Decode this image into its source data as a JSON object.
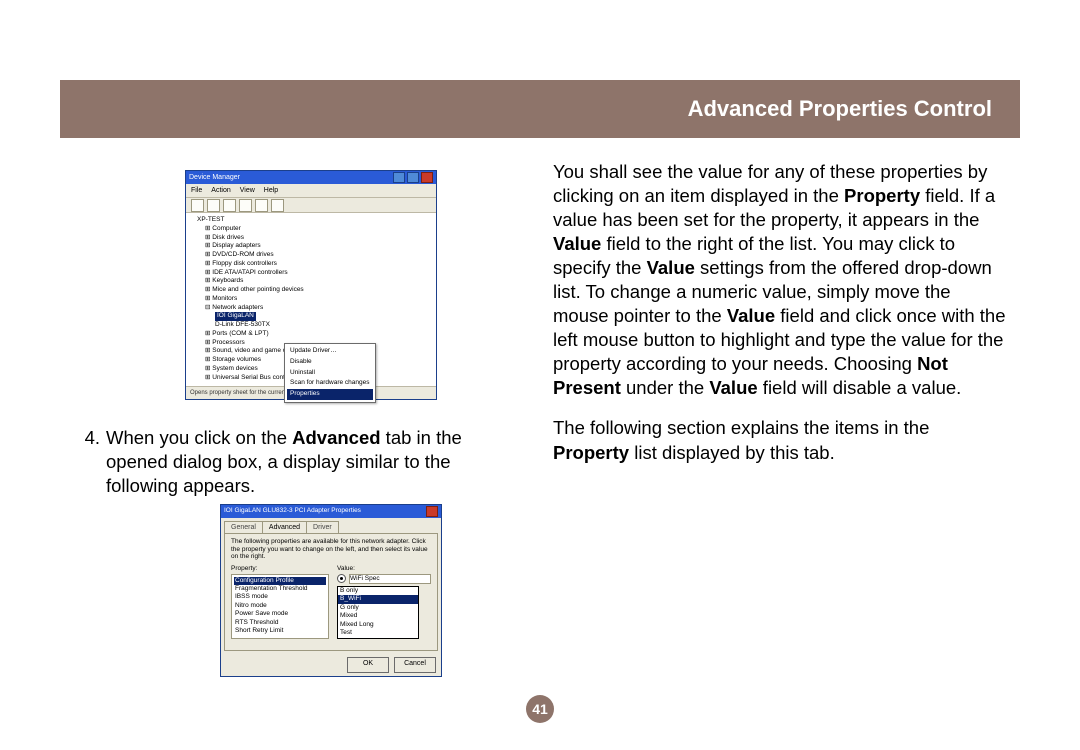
{
  "header": {
    "title": "Advanced Properties Control"
  },
  "page_number": "41",
  "left": {
    "step_num": "4.",
    "step_text_before": "When you click on the ",
    "step_bold": "Advanced",
    "step_text_after": " tab in the opened dialog box, a display similar to the following appears."
  },
  "right": {
    "p1": {
      "s1": "You shall see the value for any of these properties by clicking on an item displayed in the ",
      "b1": "Property",
      "s2": " field. If a value has been set for the property, it appears in the ",
      "b2": "Value",
      "s3": " field to the right of the list. You may click to specify the ",
      "b3": "Value",
      "s4": " settings from the offered drop-down list. To change a numeric value, simply move the mouse pointer to the ",
      "b4": "Value",
      "s5": " field and click once with the left mouse button to highlight and type the value for the property according to your needs. Choosing ",
      "b5": "Not Present",
      "s6": " under the ",
      "b6": "Value",
      "s7": " field will disable a value."
    },
    "p2": {
      "s1": "The following section explains the items in the ",
      "b1": "Property",
      "s2": " list displayed by this tab."
    }
  },
  "fig1": {
    "title": "Device Manager",
    "menu": [
      "File",
      "Action",
      "View",
      "Help"
    ],
    "tree": [
      "XP-TEST",
      "Computer",
      "Disk drives",
      "Display adapters",
      "DVD/CD-ROM drives",
      "Floppy disk controllers",
      "IDE ATA/ATAPI controllers",
      "Keyboards",
      "Mice and other pointing devices",
      "Monitors",
      "Network adapters",
      "IOI GigaLAN",
      "D-Link DFE-530TX",
      "Ports (COM & LPT)",
      "Processors",
      "Sound, video and game controllers",
      "Storage volumes",
      "System devices",
      "Universal Serial Bus controllers"
    ],
    "ctx": [
      "Update Driver…",
      "Disable",
      "Uninstall",
      "Scan for hardware changes",
      "Properties"
    ],
    "status": "Opens property sheet for the current selection."
  },
  "fig2": {
    "title": "IOI GigaLAN GLU832-3 PCI Adapter Properties",
    "tabs": [
      "General",
      "Advanced",
      "Driver"
    ],
    "hint": "The following properties are available for this network adapter. Click the property you want to change on the left, and then select its value on the right.",
    "label_prop": "Property:",
    "label_val": "Value:",
    "props": [
      "Configuration Profile",
      "Fragmentation Threshold",
      "IBSS mode",
      "Nitro mode",
      "Power Save mode",
      "RTS Threshold",
      "Short Retry Limit"
    ],
    "val_selected": "WiFi Spec",
    "dd": [
      "B only",
      "B_WiFi",
      "G only",
      "Mixed",
      "Mixed Long",
      "Test"
    ],
    "ok": "OK",
    "cancel": "Cancel"
  }
}
